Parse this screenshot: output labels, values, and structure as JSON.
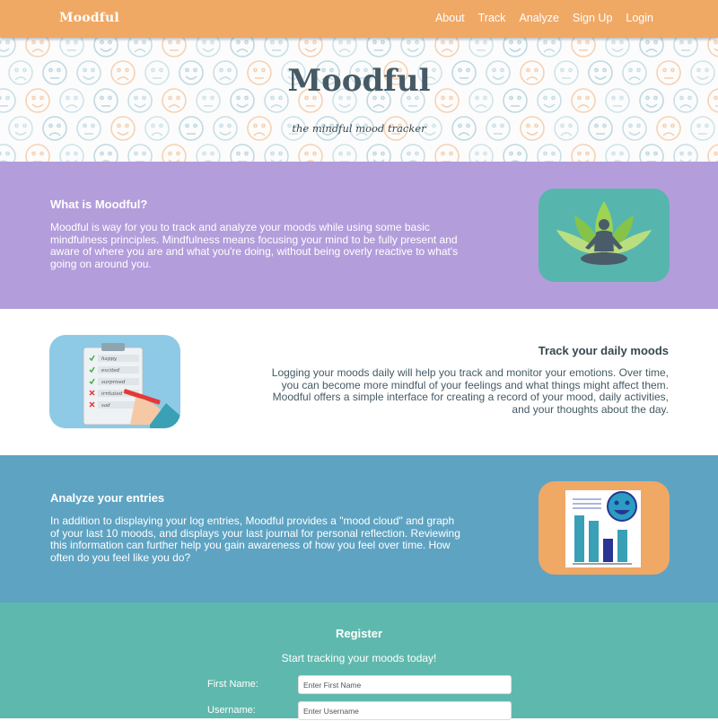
{
  "brand": "Moodful",
  "nav": [
    "About",
    "Track",
    "Analyze",
    "Sign Up",
    "Login"
  ],
  "hero": {
    "title": "Moodful",
    "subtitle": "the mindful mood tracker"
  },
  "sections": {
    "about": {
      "title": "What is Moodful?",
      "text": "Moodful is way for you to track and analyze your moods while using some basic mindfulness principles. Mindfulness means focusing your mind to be fully present and aware of where you are and what you're doing, without being overly reactive to what's going on around you."
    },
    "track": {
      "title": "Track your daily moods",
      "text": "Logging your moods daily will help you track and monitor your emotions. Over time, you can become more mindful of your feelings and what things might affect them. Moodful offers a simple interface for creating a record of your mood, daily activities, and your thoughts about the day.",
      "checklist": [
        "happy",
        "excited",
        "surprised",
        "irritated",
        "sad"
      ]
    },
    "analyze": {
      "title": "Analyze your entries",
      "text": "In addition to displaying your log entries, Moodful provides a \"mood cloud\" and graph of your last 10 moods, and displays your last journal for personal reflection. Reviewing this information can further help you gain awareness of how you feel over time. How often do you feel like you do?"
    }
  },
  "register": {
    "title": "Register",
    "subtitle": "Start tracking your moods today!",
    "fields": [
      {
        "label": "First Name:",
        "placeholder": "Enter First Name"
      },
      {
        "label": "Username:",
        "placeholder": "Enter Username"
      }
    ]
  },
  "colors": {
    "nav": "#f0a865",
    "purple": "#b39ddb",
    "blue": "#5ea3c2",
    "teal": "#5fb8ad"
  }
}
